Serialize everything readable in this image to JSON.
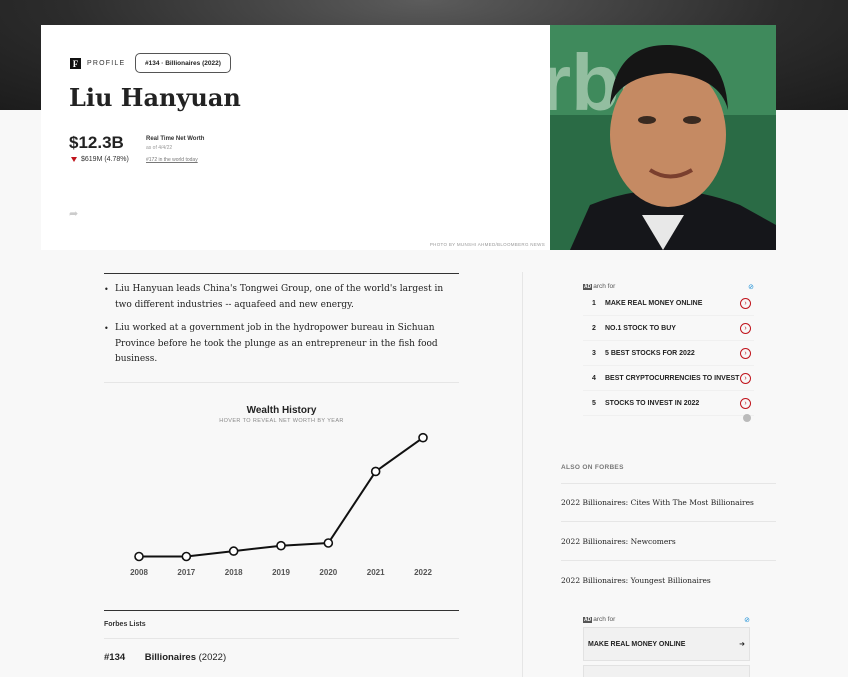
{
  "profile": {
    "brand_tag": "PROFILE",
    "logo_letter": "F",
    "rank_badge": "#134 · Billionaires (2022)",
    "name": "Liu Hanyuan",
    "net_worth": "$12.3B",
    "change": "$619M (4.78%)",
    "real_time_label": "Real Time Net Worth",
    "as_of": "as of 4/4/22",
    "world_rank": "#172 in the world today",
    "share_icon": "share-arrow-icon",
    "photo_credit": "PHOTO BY MUNSHI AHMED/BLOOMBERG NEWS"
  },
  "bullets": [
    "Liu Hanyuan leads China's Tongwei Group, one of the world's largest in two different industries -- aquafeed and new energy.",
    "Liu worked at a government job in the hydropower bureau in Sichuan Province before he took the plunge as an entrepreneur in the fish food business."
  ],
  "chart_data": {
    "type": "line",
    "title": "Wealth History",
    "subtitle": "HOVER TO REVEAL NET WORTH BY YEAR",
    "categories": [
      "2008",
      "2017",
      "2018",
      "2019",
      "2020",
      "2021",
      "2022"
    ],
    "values": [
      1.0,
      1.0,
      1.4,
      1.8,
      2.0,
      7.3,
      9.8
    ],
    "ylim": [
      0,
      10
    ],
    "grid": false
  },
  "lists": {
    "title": "Forbes Lists",
    "rank": "#134",
    "list_name": "Billionaires",
    "year": "(2022)"
  },
  "ad1": {
    "ad_badge": "AD",
    "label_rest": "arch for",
    "items": [
      {
        "num": "1",
        "text": "MAKE REAL MONEY ONLINE"
      },
      {
        "num": "2",
        "text": "NO.1 STOCK TO BUY"
      },
      {
        "num": "3",
        "text": "5 BEST STOCKS FOR 2022"
      },
      {
        "num": "4",
        "text": "BEST CRYPTOCURRENCIES TO INVEST"
      },
      {
        "num": "5",
        "text": "STOCKS TO INVEST IN 2022"
      }
    ]
  },
  "also": {
    "title": "ALSO ON FORBES",
    "items": [
      "2022 Billionaires: Cites With The Most Billionaires",
      "2022 Billionaires: Newcomers",
      "2022 Billionaires: Youngest Billionaires"
    ]
  },
  "ad2": {
    "ad_badge": "AD",
    "label_rest": "arch for",
    "item": "MAKE REAL MONEY ONLINE"
  },
  "colors": {
    "accent_red": "#c0141c",
    "ad_blue": "#1e90d6"
  }
}
